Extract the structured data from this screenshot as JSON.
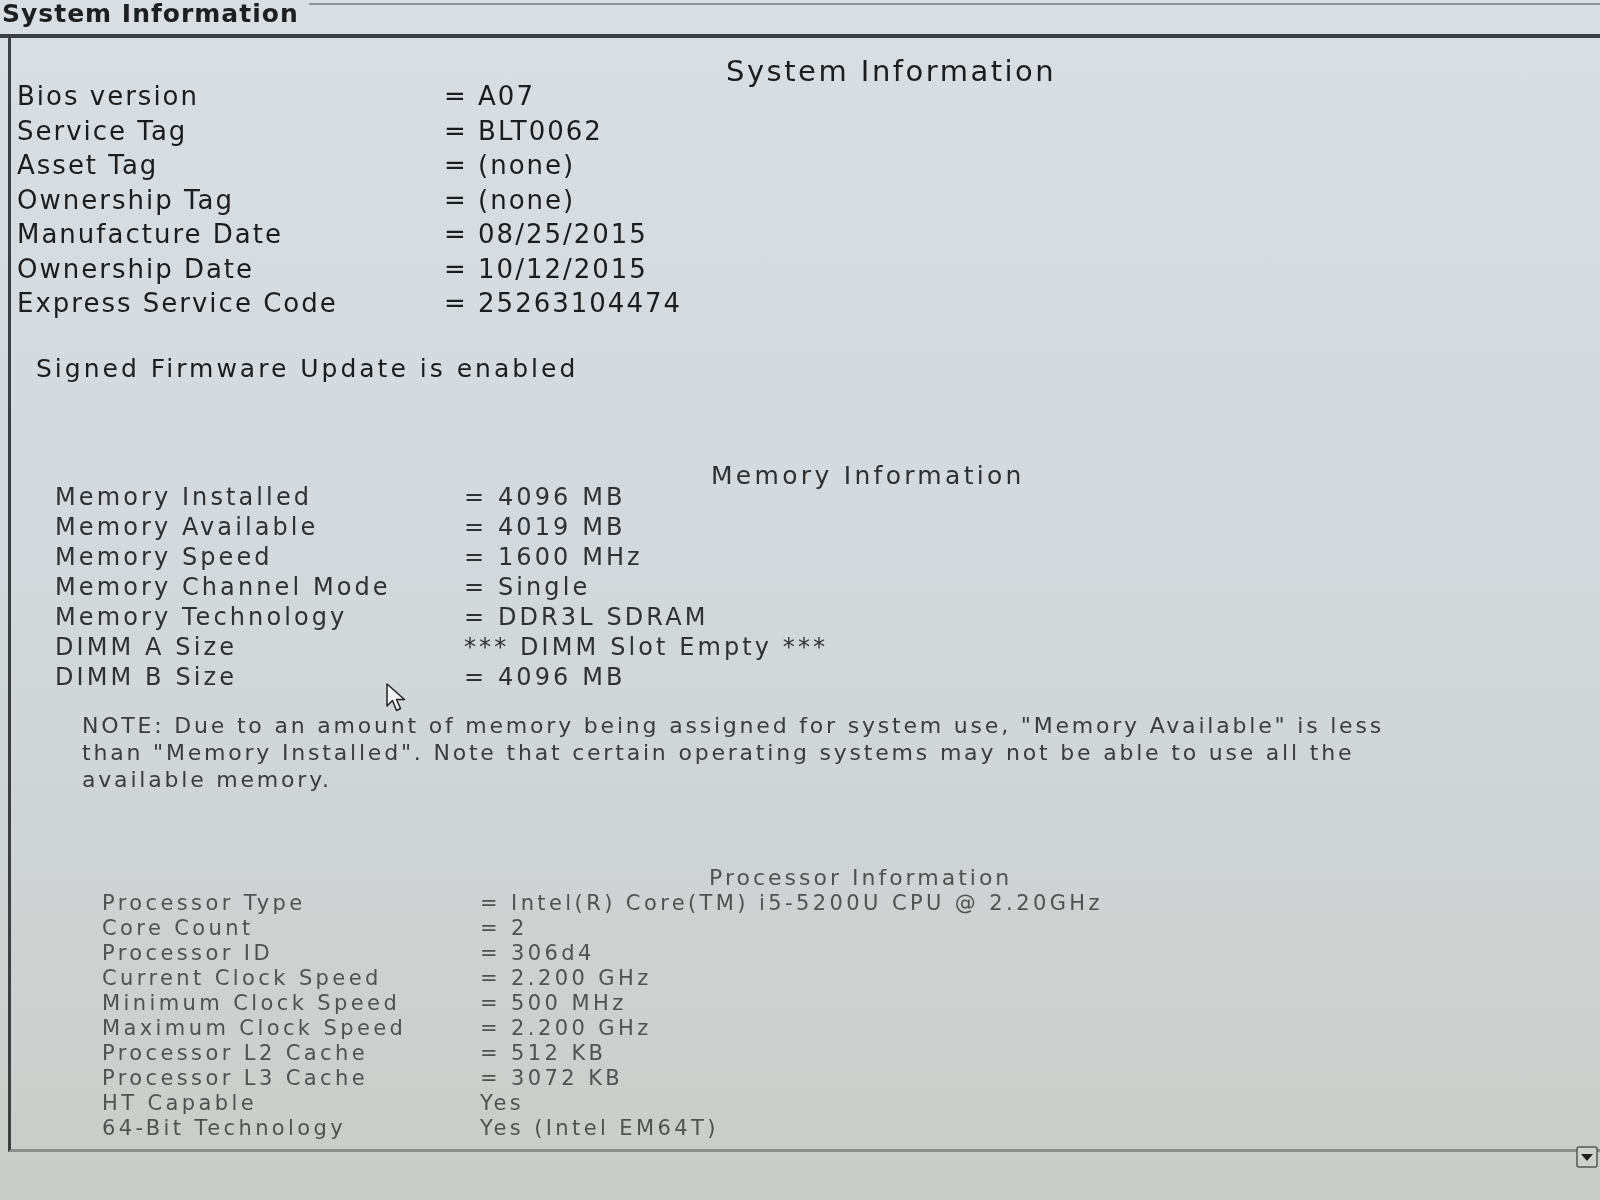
{
  "window": {
    "title": "System Information"
  },
  "sections": [
    {
      "heading": "System Information",
      "rows": [
        {
          "label": "Bios version",
          "value": "= A07"
        },
        {
          "label": "Service Tag",
          "value": "= BLT0062"
        },
        {
          "label": "Asset Tag",
          "value": "= (none)"
        },
        {
          "label": "Ownership Tag",
          "value": "= (none)"
        },
        {
          "label": "Manufacture Date",
          "value": "= 08/25/2015"
        },
        {
          "label": "Ownership Date",
          "value": "= 10/12/2015"
        },
        {
          "label": "Express Service Code",
          "value": "= 25263104474"
        }
      ],
      "status": "Signed Firmware Update is enabled"
    },
    {
      "heading": "Memory Information",
      "rows": [
        {
          "label": "Memory Installed",
          "value": "= 4096 MB"
        },
        {
          "label": "Memory Available",
          "value": "= 4019 MB"
        },
        {
          "label": "Memory Speed",
          "value": "= 1600 MHz"
        },
        {
          "label": "Memory Channel Mode",
          "value": "= Single"
        },
        {
          "label": "Memory Technology",
          "value": "= DDR3L SDRAM"
        },
        {
          "label": "DIMM A Size",
          "value": "*** DIMM Slot Empty ***"
        },
        {
          "label": "DIMM B Size",
          "value": "= 4096 MB"
        }
      ],
      "note": "NOTE: Due to an amount of memory being assigned for system use, \"Memory Available\" is less than \"Memory Installed\". Note that certain operating systems may not be able to use all the available memory."
    },
    {
      "heading": "Processor Information",
      "rows": [
        {
          "label": "Processor Type",
          "value": "= Intel(R) Core(TM) i5-5200U CPU @ 2.20GHz"
        },
        {
          "label": "Core Count",
          "value": "= 2"
        },
        {
          "label": "Processor ID",
          "value": "= 306d4"
        },
        {
          "label": "Current Clock Speed",
          "value": "= 2.200 GHz"
        },
        {
          "label": "Minimum Clock Speed",
          "value": "= 500 MHz"
        },
        {
          "label": "Maximum Clock Speed",
          "value": "= 2.200 GHz"
        },
        {
          "label": "Processor L2 Cache",
          "value": "= 512 KB"
        },
        {
          "label": "Processor L3 Cache",
          "value": "= 3072 KB"
        },
        {
          "label": "HT Capable",
          "value": "Yes"
        },
        {
          "label": "64-Bit Technology",
          "value": "Yes (Intel EM64T)"
        }
      ]
    }
  ]
}
